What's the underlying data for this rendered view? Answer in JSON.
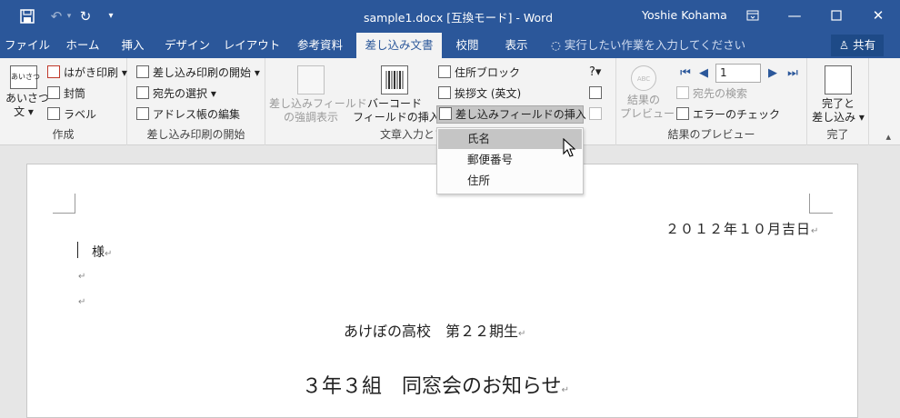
{
  "titlebar": {
    "document_title": "sample1.docx [互換モード] - Word",
    "user_name": "Yoshie Kohama",
    "save_icon": "save-icon",
    "undo_icon": "undo-icon",
    "redo_icon": "redo-icon",
    "customize_icon": "customize-quick-access-icon"
  },
  "tabs": [
    "ファイル",
    "ホーム",
    "挿入",
    "デザイン",
    "レイアウト",
    "参考資料",
    "差し込み文書",
    "校閲",
    "表示"
  ],
  "active_tab": "差し込み文書",
  "tell_me": "実行したい作業を入力してください",
  "share": "共有",
  "ribbon": {
    "create": {
      "label": "作成",
      "greeting_line1": "あいさつ",
      "greeting_line2": "文 ▾",
      "postcard": "はがき印刷 ▾",
      "envelope": "封筒",
      "label_btn": "ラベル"
    },
    "start": {
      "label": "差し込み印刷の開始",
      "start_merge": "差し込み印刷の開始 ▾",
      "select_recipients": "宛先の選択 ▾",
      "edit_list": "アドレス帳の編集"
    },
    "write": {
      "label": "文章入力とフ",
      "highlight_line1": "差し込みフィールド",
      "highlight_line2": "の強調表示",
      "barcode_line1": "バーコード",
      "barcode_line2": "フィールドの挿入 ▾",
      "address_block": "住所ブロック",
      "greeting_line": "挨拶文 (英文)",
      "insert_field": "差し込みフィールドの挿入 ▾"
    },
    "preview": {
      "label": "結果のプレビュー",
      "preview_line1": "結果の",
      "preview_line2": "プレビュー",
      "record": "1",
      "find_recipient": "宛先の検索",
      "check_errors": "エラーのチェック"
    },
    "finish": {
      "label": "完了",
      "finish_line1": "完了と",
      "finish_line2": "差し込み ▾"
    }
  },
  "dropdown": {
    "items": [
      "氏名",
      "郵便番号",
      "住所"
    ],
    "highlighted": "氏名"
  },
  "document": {
    "date": "２０１２年１０月吉日",
    "salutation": "様",
    "school": "あけぼの高校　第２２期生",
    "title": "３年３組　同窓会のお知らせ",
    "para_mark": "↵"
  },
  "colors": {
    "word_blue": "#2b579a",
    "ribbon_bg": "#f3f3f3",
    "highlight": "#c5c5c5"
  }
}
